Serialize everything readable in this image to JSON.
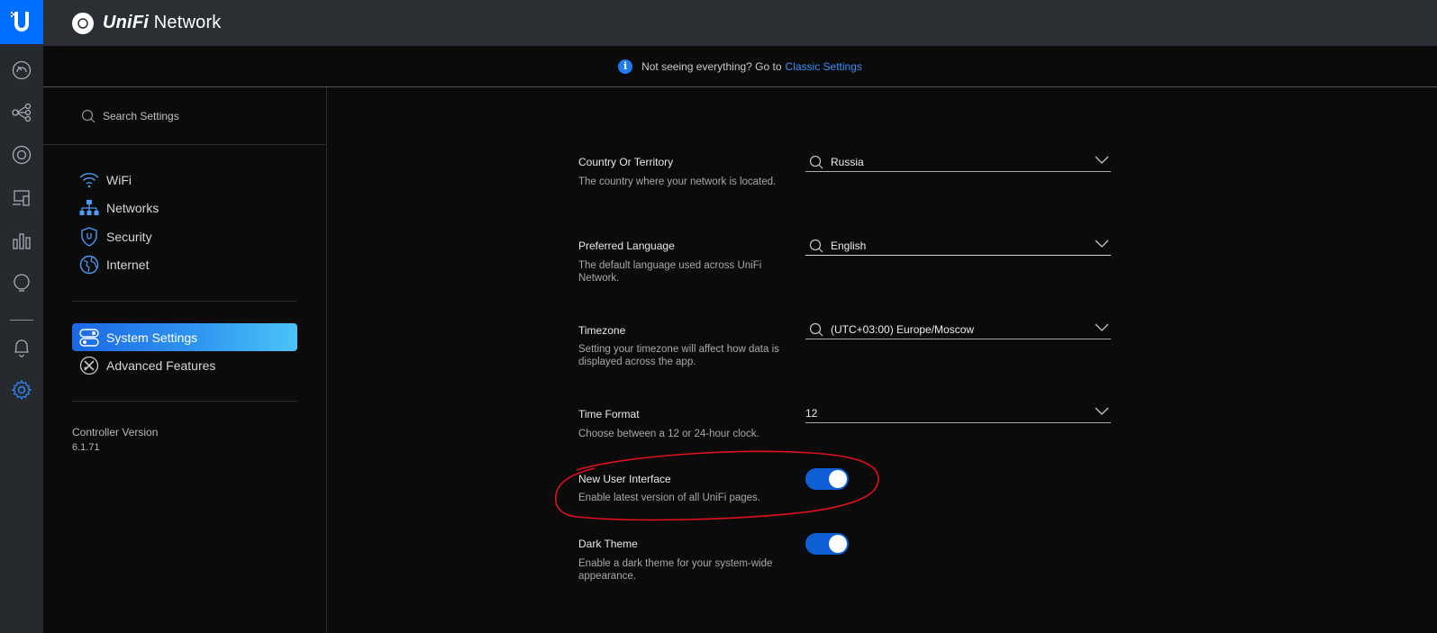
{
  "app": {
    "title_brand": "UniFi",
    "title_rest": " Network"
  },
  "rail": {
    "icons": [
      "ubiquiti-logo-icon",
      "dashboard-icon",
      "topology-icon",
      "devices-icon",
      "clients-icon",
      "statistics-icon",
      "insights-icon",
      "alerts-icon",
      "settings-icon"
    ]
  },
  "notice": {
    "text": "Not seeing everything? Go to",
    "link": "Classic Settings"
  },
  "sidebar": {
    "search_placeholder": "Search Settings",
    "items": [
      {
        "label": "WiFi",
        "icon": "wifi-icon"
      },
      {
        "label": "Networks",
        "icon": "networks-icon"
      },
      {
        "label": "Security",
        "icon": "shield-icon"
      },
      {
        "label": "Internet",
        "icon": "globe-icon"
      }
    ],
    "system_items": [
      {
        "label": "System Settings",
        "icon": "system-settings-icon",
        "active": true
      },
      {
        "label": "Advanced Features",
        "icon": "tools-icon",
        "active": false
      }
    ],
    "version_label": "Controller Version",
    "version_value": "6.1.71"
  },
  "settings": {
    "country": {
      "title": "Country Or Territory",
      "desc": "The country where your network is located.",
      "value": "Russia"
    },
    "language": {
      "title": "Preferred Language",
      "desc": "The default language used across UniFi Network.",
      "value": "English"
    },
    "timezone": {
      "title": "Timezone",
      "desc": "Setting your timezone will affect how data is displayed across the app.",
      "value": "(UTC+03:00) Europe/Moscow"
    },
    "time_format": {
      "title": "Time Format",
      "desc": "Choose between a 12 or 24-hour clock.",
      "value": "12"
    },
    "new_ui": {
      "title": "New User Interface",
      "desc": "Enable latest version of all UniFi pages.",
      "enabled": true
    },
    "dark_theme": {
      "title": "Dark Theme",
      "desc": "Enable a dark theme for your system-wide appearance.",
      "enabled": true
    }
  },
  "colors": {
    "accent": "#006fff",
    "toggle_on": "#0f5fd6",
    "annotation": "#e0111d",
    "link": "#3d8ef8"
  }
}
